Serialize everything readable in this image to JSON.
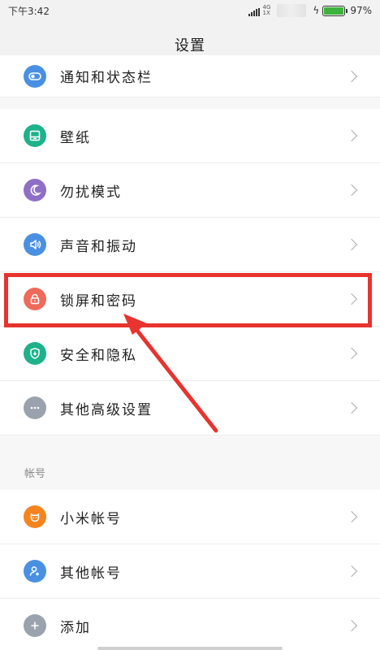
{
  "status_bar": {
    "time": "下午3:42",
    "network_top": "4G",
    "network_bottom": "1X",
    "battery": "97%"
  },
  "header": {
    "title": "设置"
  },
  "settings": {
    "items": [
      {
        "label": "通知和状态栏",
        "icon": "toggle-icon",
        "color": "#4a90e2"
      },
      {
        "label": "壁纸",
        "icon": "wallpaper-icon",
        "color": "#1db28a"
      },
      {
        "label": "勿扰模式",
        "icon": "moon-icon",
        "color": "#8e6fc6"
      },
      {
        "label": "声音和振动",
        "icon": "speaker-icon",
        "color": "#4a90e2"
      },
      {
        "label": "锁屏和密码",
        "icon": "lock-icon",
        "color": "#ee6a5a"
      },
      {
        "label": "安全和隐私",
        "icon": "shield-icon",
        "color": "#1db28a"
      },
      {
        "label": "其他高级设置",
        "icon": "more-icon",
        "color": "#9aa3ad"
      }
    ]
  },
  "accounts": {
    "header": "帐号",
    "items": [
      {
        "label": "小米帐号",
        "icon": "mi-icon",
        "color": "#f5841f"
      },
      {
        "label": "其他帐号",
        "icon": "user-add-icon",
        "color": "#4a90e2"
      },
      {
        "label": "添加",
        "icon": "plus-icon",
        "color": "#9aa3ad"
      }
    ]
  },
  "colors": {
    "highlight": "#e8332e",
    "battery": "#3db33d"
  }
}
